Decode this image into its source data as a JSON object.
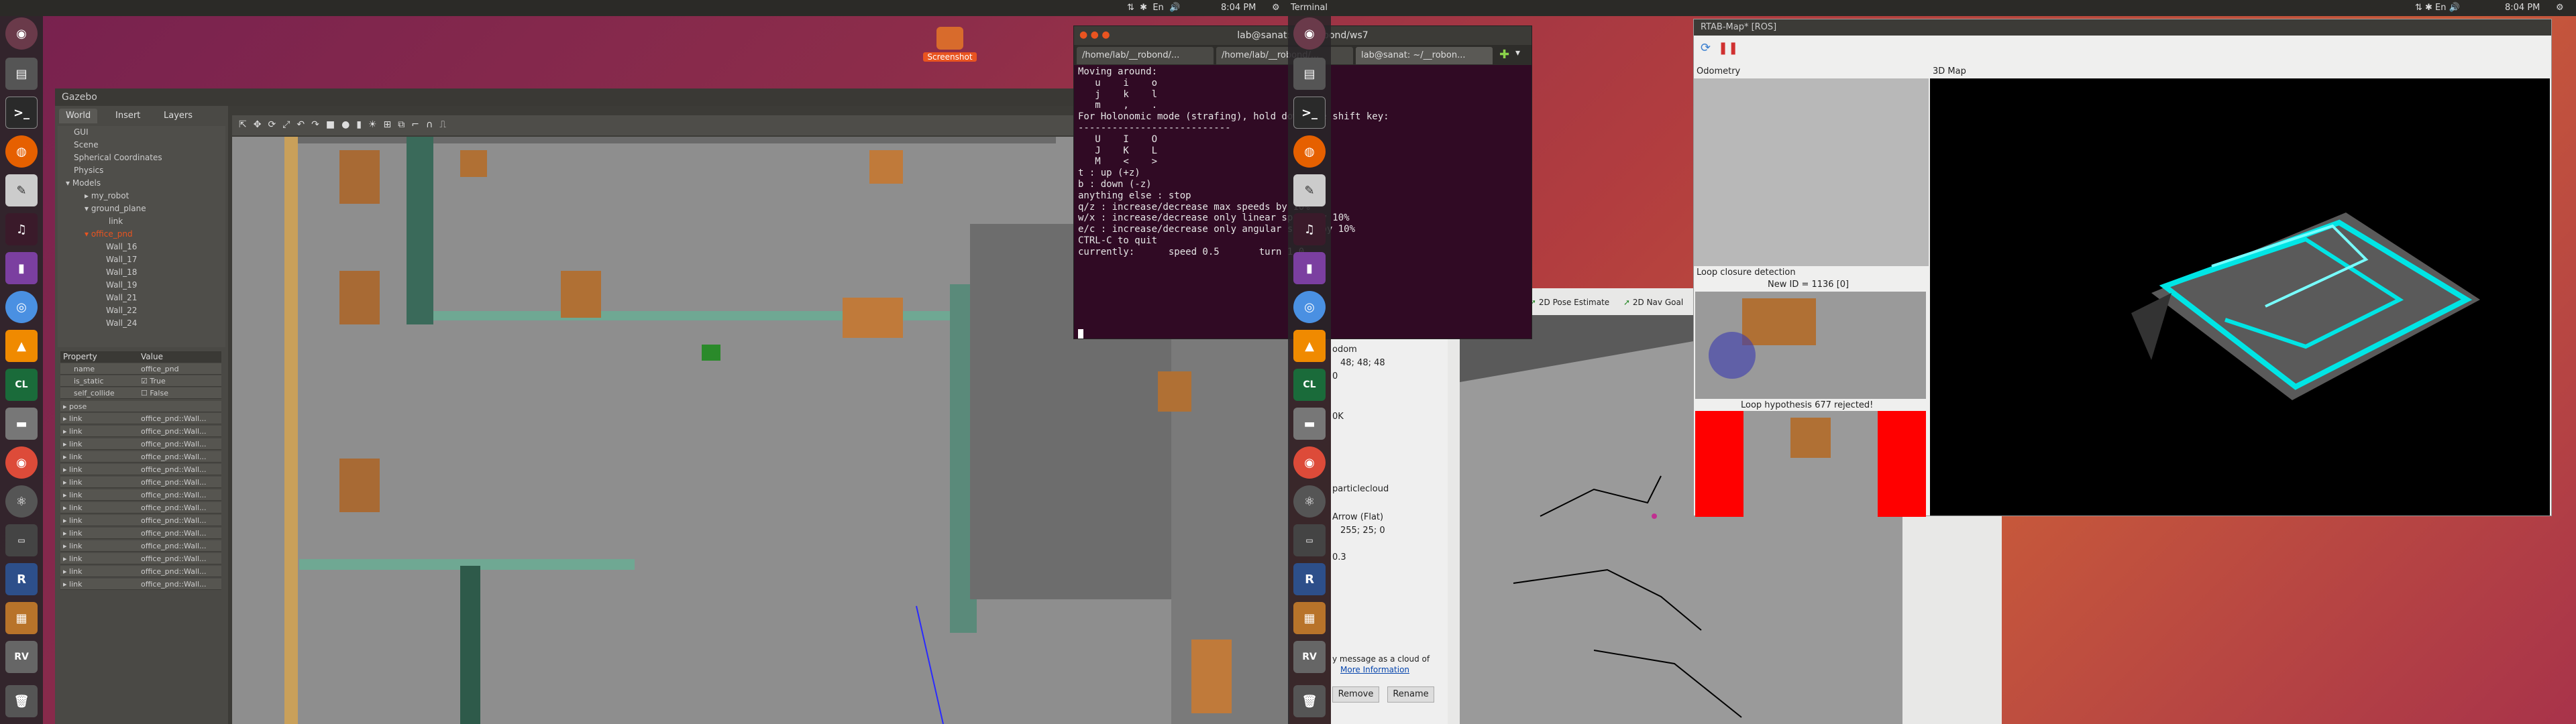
{
  "topbar": {
    "time": "8:04 PM",
    "app_name": "Terminal",
    "right_time": "8:04 PM",
    "indicators": [
      "⇅",
      "✱",
      "En",
      "🔊"
    ]
  },
  "desktop": {
    "screenshot_label": "Screenshot"
  },
  "gazebo": {
    "title": "Gazebo",
    "tabs": [
      "World",
      "Insert",
      "Layers"
    ],
    "tree": [
      "GUI",
      "Scene",
      "Spherical Coordinates",
      "Physics",
      "Models",
      "my_robot",
      "ground_plane",
      "link",
      "office_pnd",
      "Wall_16",
      "Wall_17",
      "Wall_18",
      "Wall_19",
      "Wall_21",
      "Wall_22",
      "Wall_24"
    ],
    "prop_headers": [
      "Property",
      "Value"
    ],
    "props": [
      [
        "name",
        "office_pnd"
      ],
      [
        "is_static",
        "True"
      ],
      [
        "self_collide",
        "False"
      ],
      [
        "pose",
        ""
      ]
    ],
    "link_rows": [
      "link",
      "link",
      "link",
      "link",
      "link",
      "link",
      "link",
      "link",
      "link",
      "link",
      "link",
      "link",
      "link",
      "link"
    ],
    "link_value": "office_pnd::Wall..."
  },
  "terminal": {
    "title": "lab@sanat: ~/__robond/ws7",
    "tabs": [
      "/home/lab/__robond/...",
      "/home/lab/__robond/...",
      "lab@sanat: ~/__robon..."
    ],
    "lines": [
      "Moving around:",
      "   u    i    o",
      "   j    k    l",
      "   m    ,    .",
      "",
      "For Holonomic mode (strafing), hold down the shift key:",
      "---------------------------",
      "   U    I    O",
      "   J    K    L",
      "   M    <    >",
      "",
      "t : up (+z)",
      "b : down (-z)",
      "",
      "anything else : stop",
      "",
      "q/z : increase/decrease max speeds by 10%",
      "w/x : increase/decrease only linear speed by 10%",
      "e/c : increase/decrease only angular speed by 10%",
      "",
      "CTRL-C to quit",
      "",
      "currently:      speed 0.5       turn 1.0"
    ]
  },
  "rviz": {
    "toolbar": [
      "2D Pose Estimate",
      "2D Nav Goal"
    ],
    "items": [
      "odom",
      "48; 48; 48",
      "0",
      "0K",
      "particlecloud",
      "Arrow (Flat)",
      "255; 25; 0",
      "0.3"
    ],
    "hint": "y message as a cloud of",
    "more_info": "More Information",
    "buttons": [
      "Remove",
      "Rename"
    ]
  },
  "rtabmap": {
    "title": "RTAB-Map* [ROS]",
    "odometry_label": "Odometry",
    "map3d_label": "3D Map",
    "loop_label": "Loop closure detection",
    "new_id": "New ID = 1136 [0]",
    "loop_hyp": "Loop hypothesis 677 rejected!"
  },
  "colors": {
    "terminal_bg": "#300a24",
    "accent": "#e95420",
    "map_cyan": "#00e5e5"
  }
}
